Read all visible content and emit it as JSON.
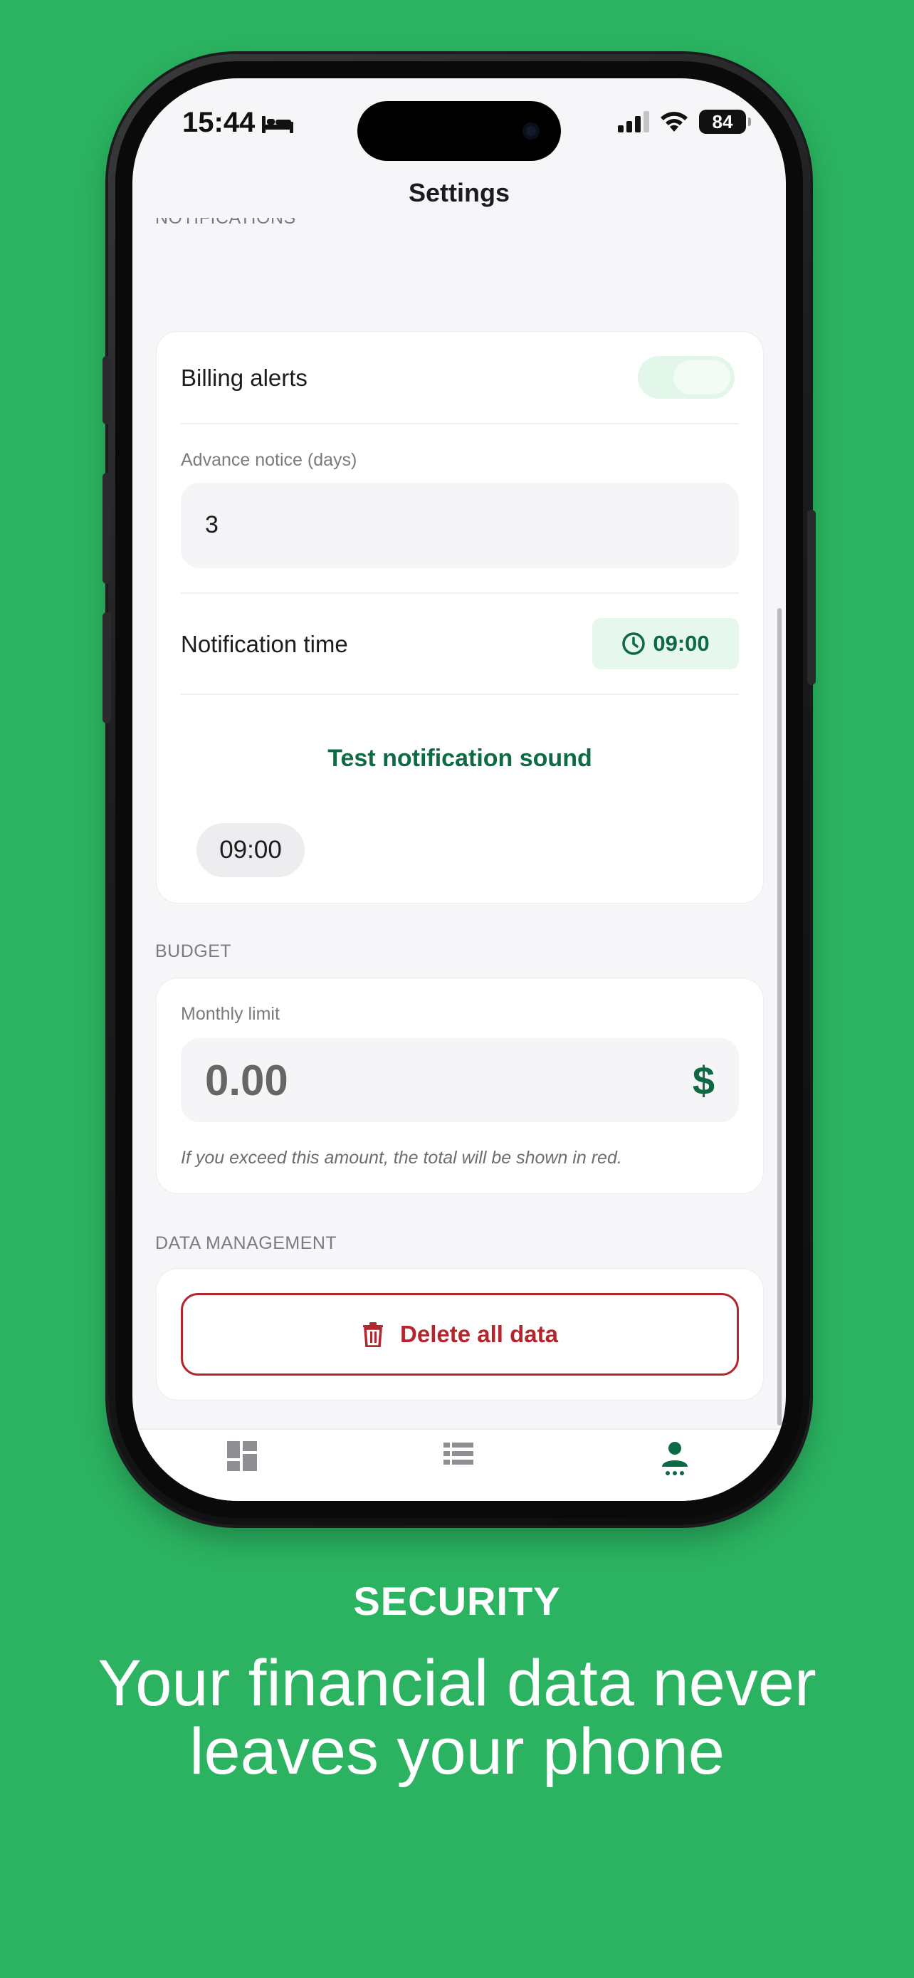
{
  "status_bar": {
    "time": "15:44",
    "battery": "84",
    "icons": [
      "bed-icon",
      "signal-icon",
      "wifi-icon",
      "battery-icon"
    ]
  },
  "nav": {
    "title": "Settings"
  },
  "notifications": {
    "section_label": "NOTIFICATIONS",
    "billing_alerts_label": "Billing alerts",
    "billing_alerts_on": true,
    "advance_notice_label": "Advance notice (days)",
    "advance_notice_value": "3",
    "notification_time_label": "Notification time",
    "notification_time_value": "09:00",
    "test_sound_label": "Test notification sound",
    "time_pill": "09:00"
  },
  "budget": {
    "section_label": "BUDGET",
    "monthly_limit_label": "Monthly limit",
    "monthly_limit_value": "0.00",
    "currency_symbol": "$",
    "hint": "If you exceed this amount, the total will be shown in red."
  },
  "data_management": {
    "section_label": "DATA MANAGEMENT",
    "delete_label": "Delete all data"
  },
  "tab_bar": {
    "tabs": [
      {
        "icon": "dashboard-icon",
        "active": false
      },
      {
        "icon": "list-icon",
        "active": false
      },
      {
        "icon": "profile-icon",
        "active": true
      }
    ]
  },
  "colors": {
    "background": "#2BB361",
    "accent": "#0E6A45",
    "danger": "#B3262D"
  },
  "marketing": {
    "eyebrow": "SECURITY",
    "headline": "Your financial data never leaves your phone"
  }
}
